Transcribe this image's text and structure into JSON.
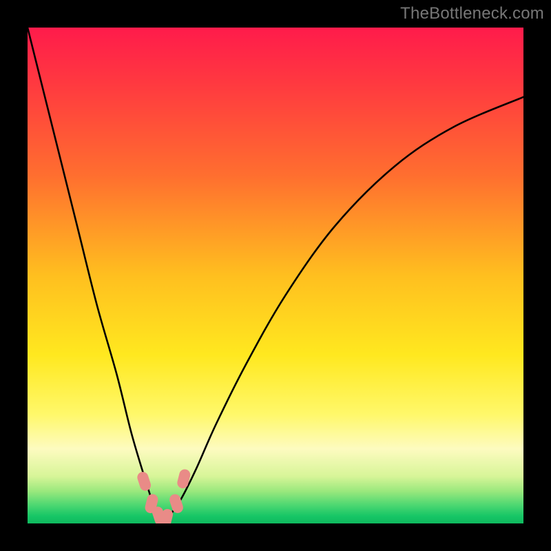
{
  "watermark": {
    "text": "TheBottleneck.com"
  },
  "colors": {
    "frame": "#000000",
    "curve": "#000000",
    "marker_fill": "#e98b87",
    "gradient_stops": [
      {
        "offset": 0.0,
        "color": "#ff1b4b"
      },
      {
        "offset": 0.12,
        "color": "#ff3b3f"
      },
      {
        "offset": 0.3,
        "color": "#ff6f2f"
      },
      {
        "offset": 0.5,
        "color": "#ffbf1f"
      },
      {
        "offset": 0.66,
        "color": "#ffe81f"
      },
      {
        "offset": 0.78,
        "color": "#fff86a"
      },
      {
        "offset": 0.85,
        "color": "#fdfbc0"
      },
      {
        "offset": 0.905,
        "color": "#d7f598"
      },
      {
        "offset": 0.935,
        "color": "#9ae87d"
      },
      {
        "offset": 0.962,
        "color": "#4fd872"
      },
      {
        "offset": 0.985,
        "color": "#17c666"
      },
      {
        "offset": 1.0,
        "color": "#0fb95e"
      }
    ]
  },
  "chart_data": {
    "type": "line",
    "title": "",
    "xlabel": "",
    "ylabel": "",
    "xlim": [
      0,
      100
    ],
    "ylim": [
      0,
      100
    ],
    "note": "V-shaped bottleneck curve; minimum ≈ x≈27, y≈0. Values are percentages of the plot area (0–100).",
    "series": [
      {
        "name": "bottleneck-curve",
        "x": [
          0,
          5,
          10,
          14,
          18,
          21,
          24,
          26,
          27,
          28,
          29,
          31,
          34,
          38,
          44,
          52,
          62,
          74,
          86,
          100
        ],
        "y": [
          100,
          80,
          60,
          44,
          30,
          18,
          8,
          2,
          0,
          0.5,
          2,
          5,
          11,
          20,
          32,
          46,
          60,
          72,
          80,
          86
        ]
      }
    ],
    "markers": {
      "name": "highlight-points",
      "x": [
        23.5,
        25.0,
        26.5,
        28.0,
        30.0,
        31.5
      ],
      "y": [
        8.5,
        4.0,
        1.5,
        1.0,
        4.0,
        9.0
      ]
    }
  }
}
